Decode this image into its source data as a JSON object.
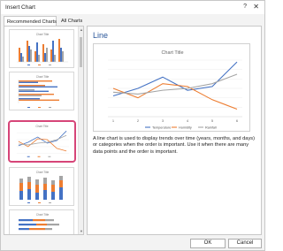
{
  "window": {
    "title": "Insert Chart",
    "help_glyph": "?",
    "close_glyph": "✕"
  },
  "tabs": [
    {
      "label": "Recommended Charts",
      "active": true
    },
    {
      "label": "All Charts",
      "active": false
    }
  ],
  "thumbnails": [
    {
      "kind": "clustered-column",
      "title": "Chart Title"
    },
    {
      "kind": "clustered-bar",
      "title": "Chart Title"
    },
    {
      "kind": "line",
      "title": "Chart Title",
      "selected": true
    },
    {
      "kind": "stacked-column",
      "title": "Chart Title"
    },
    {
      "kind": "stacked-bar",
      "title": "Chart Title"
    }
  ],
  "selected_chart": {
    "name": "Line",
    "description": "A line chart is used to display trends over time (years, months, and days) or categories when the order is important. Use it when there are many data points and the order is important."
  },
  "chart_data": {
    "type": "line",
    "title": "Chart Title",
    "categories": [
      "1",
      "2",
      "3",
      "4",
      "5",
      "6"
    ],
    "ylim": [
      0,
      60
    ],
    "series": [
      {
        "name": "Temperature",
        "color": "#4472c4",
        "values": [
          22,
          30,
          42,
          28,
          32,
          58
        ]
      },
      {
        "name": "Humidity",
        "color": "#ed7d31",
        "values": [
          30,
          20,
          35,
          32,
          18,
          8
        ]
      },
      {
        "name": "Rainfall",
        "color": "#a5a5a5",
        "values": [
          26,
          24,
          28,
          30,
          35,
          45
        ]
      }
    ],
    "legend_position": "bottom",
    "grid": true
  },
  "buttons": {
    "ok": "OK",
    "cancel": "Cancel"
  },
  "scrollbar": {
    "up": "▲",
    "down": "▼"
  },
  "colors": {
    "accent": "#2b579a",
    "selection": "#d64578",
    "orange": "#ed7d31",
    "blue": "#4472c4",
    "gray": "#a5a5a5"
  }
}
